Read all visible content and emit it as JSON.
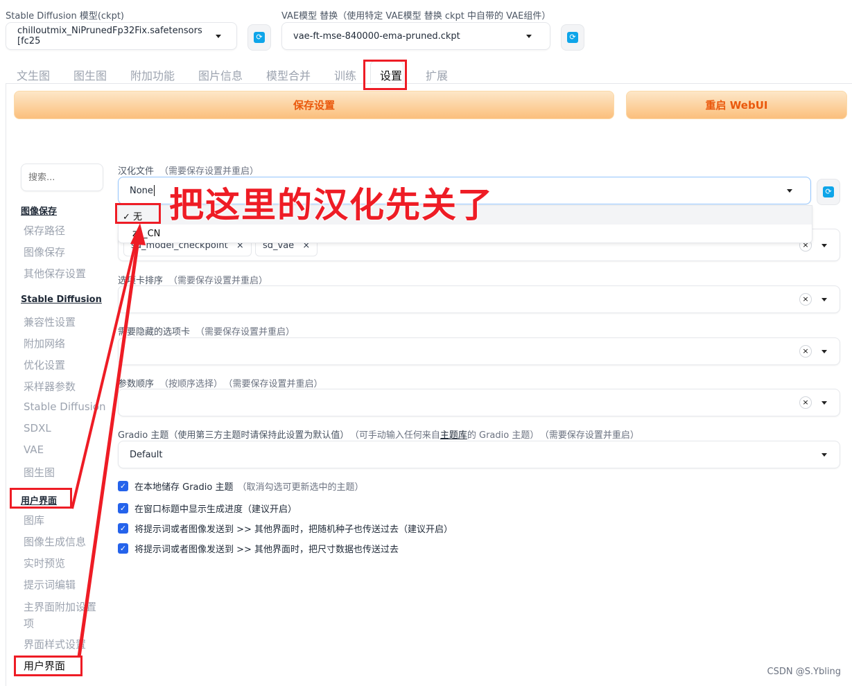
{
  "top": {
    "model_label": "Stable Diffusion 模型(ckpt)",
    "model_value": "chilloutmix_NiPrunedFp32Fix.safetensors [fc25",
    "vae_label": "VAE模型 替换（使用特定 VAE模型 替换 ckpt 中自带的 VAE组件）",
    "vae_value": "vae-ft-mse-840000-ema-pruned.ckpt"
  },
  "tabs": [
    "文生图",
    "图生图",
    "附加功能",
    "图片信息",
    "模型合并",
    "训练",
    "设置",
    "扩展"
  ],
  "active_tab": "设置",
  "buttons": {
    "save": "保存设置",
    "restart": "重启 WebUI"
  },
  "sidebar": {
    "search_placeholder": "搜索...",
    "items": [
      "图像保存",
      "保存路径",
      "图像保存",
      "其他保存设置",
      "Stable Diffusion",
      "兼容性设置",
      "附加网络",
      "优化设置",
      "采样器参数",
      "Stable Diffusion",
      "SDXL",
      "VAE",
      "图生图",
      "用户界面",
      "图库",
      "图像生成信息",
      "实时预览",
      "提示词编辑",
      "主界面附加设置项",
      "界面样式设置",
      "用户界面"
    ]
  },
  "settings": {
    "localization": {
      "label": "汉化文件",
      "note": "（需要保存设置并重启）",
      "value": "None",
      "options": [
        "✓ 无",
        "zh_CN"
      ]
    },
    "quicksettings": {
      "chips": [
        "sd_model_checkpoint",
        "sd_vae"
      ]
    },
    "tab_order": {
      "label": "选项卡排序",
      "note": "（需要保存设置并重启）"
    },
    "hidden_tabs": {
      "label": "需要隐藏的选项卡",
      "note": "（需要保存设置并重启）"
    },
    "param_order": {
      "label": "参数顺序",
      "note": "（按顺序选择）",
      "note2": "（需要保存设置并重启）"
    },
    "gradio_theme": {
      "label": "Gradio 主题（使用第三方主题时请保持此设置为默认值）",
      "note_a": "（可手动输入任何来自",
      "link": "主题库",
      "note_b": "的 Gradio 主题）",
      "note2": "（需要保存设置并重启）",
      "value": "Default"
    },
    "checkboxes": [
      {
        "label": "在本地储存 Gradio 主题",
        "note": "（取消勾选可更新选中的主题）",
        "checked": true
      },
      {
        "label": "在窗口标题中显示生成进度（建议开启）",
        "note": "",
        "checked": true
      },
      {
        "label": "将提示词或者图像发送到 >> 其他界面时，把随机种子也传送过去（建议开启）",
        "note": "",
        "checked": true
      },
      {
        "label": "将提示词或者图像发送到 >> 其他界面时，把尺寸数据也传送过去",
        "note": "",
        "checked": true
      }
    ]
  },
  "annotation": {
    "text": "把这里的汉化先关了",
    "color": "#ee1c25"
  },
  "watermark": "CSDN @S.Ybling"
}
